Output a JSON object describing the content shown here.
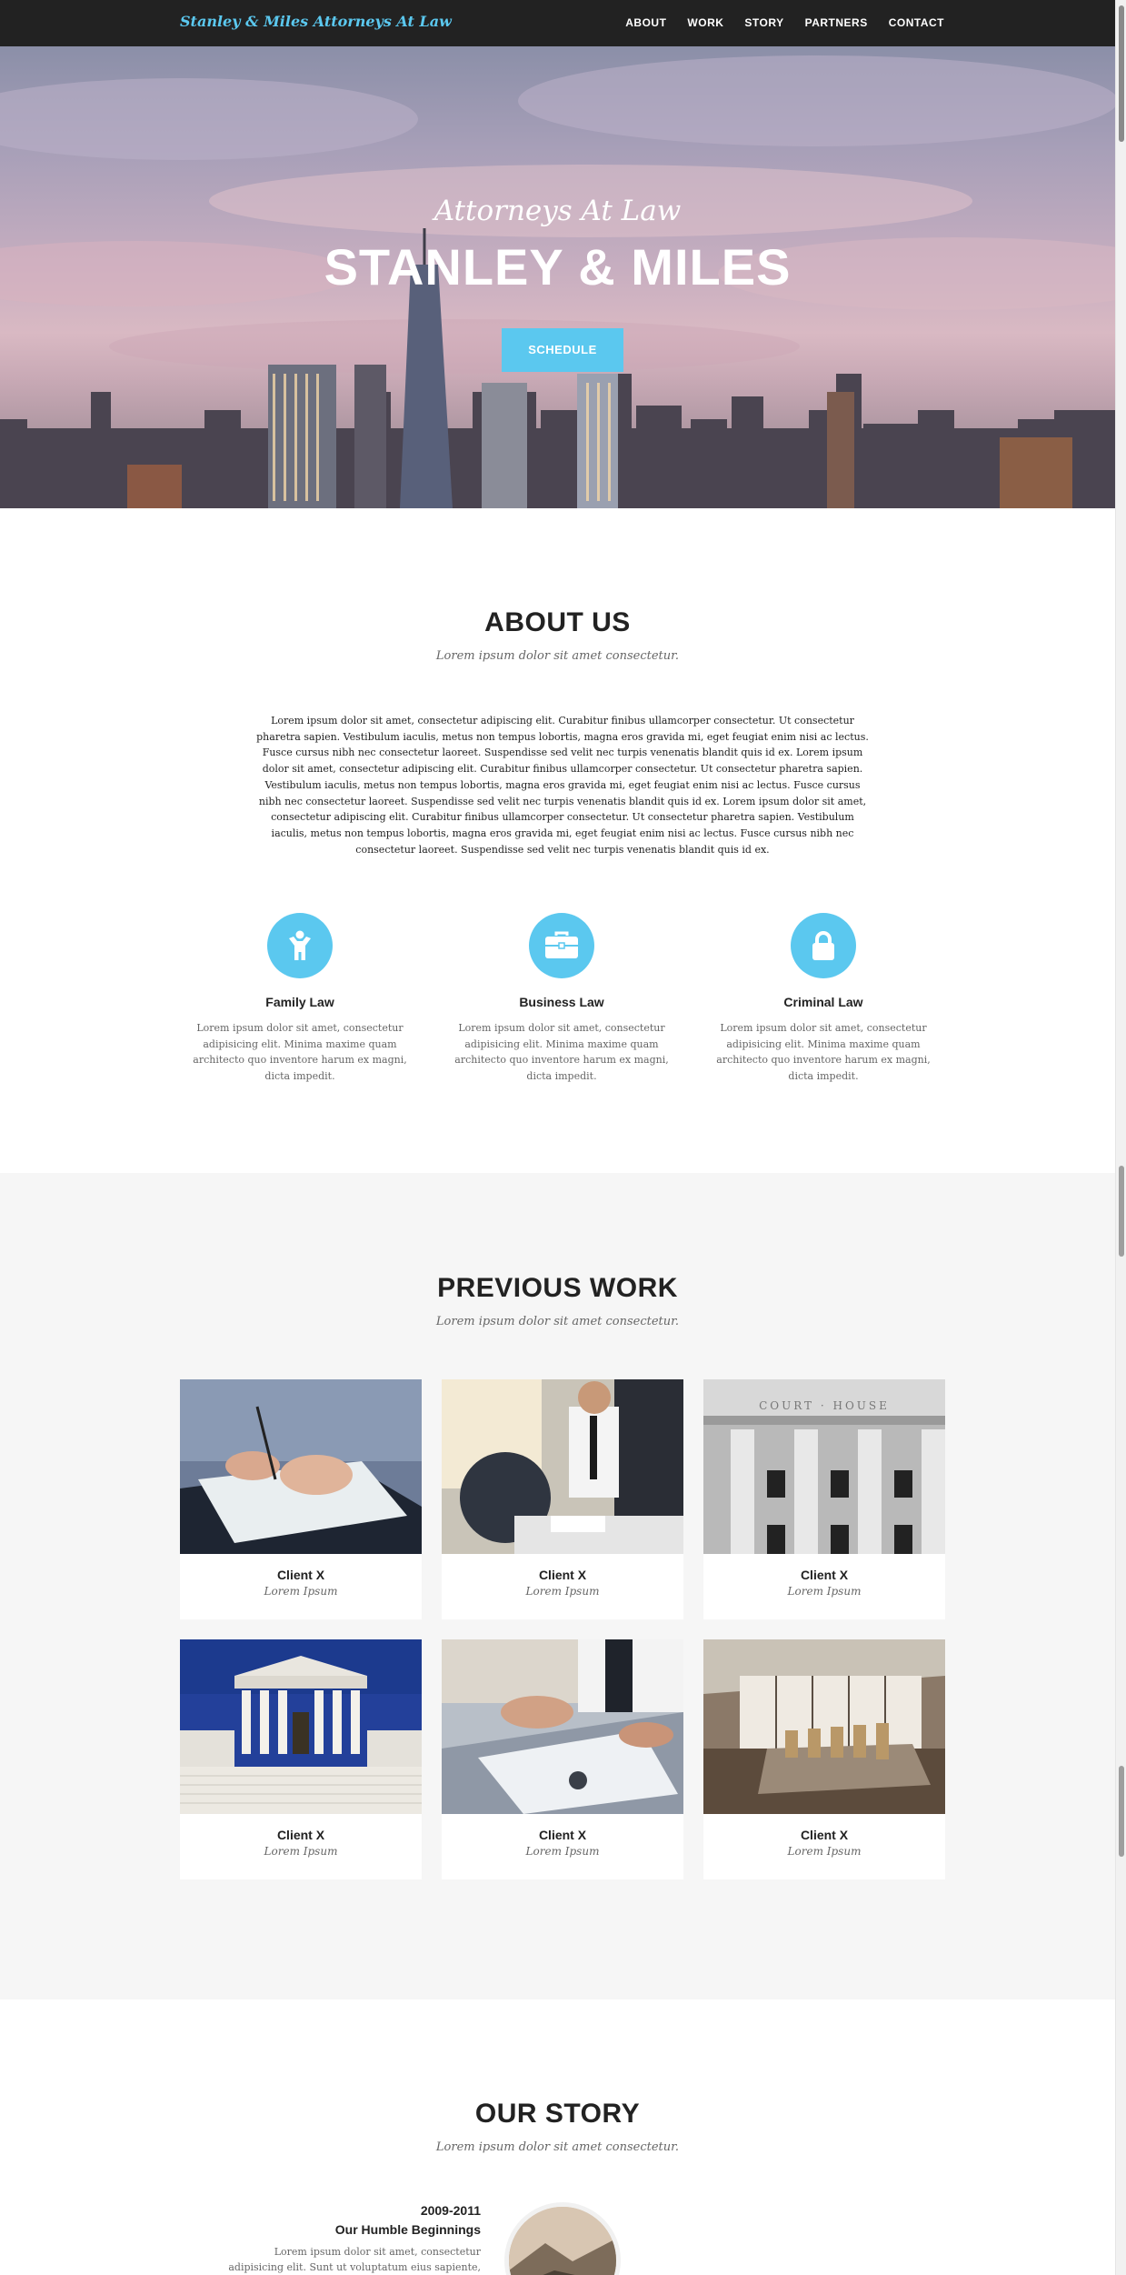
{
  "nav": {
    "brand": "Stanley & Miles Attorneys At Law",
    "items": [
      "ABOUT",
      "WORK",
      "STORY",
      "PARTNERS",
      "CONTACT"
    ]
  },
  "hero": {
    "subtitle": "Attorneys At Law",
    "title": "STANLEY & MILES",
    "button": "SCHEDULE"
  },
  "about": {
    "title": "ABOUT US",
    "subtitle": "Lorem ipsum dolor sit amet consectetur.",
    "body": "Lorem ipsum dolor sit amet, consectetur adipiscing elit. Curabitur finibus ullamcorper consectetur. Ut consectetur pharetra sapien. Vestibulum iaculis, metus non tempus lobortis, magna eros gravida mi, eget feugiat enim nisi ac lectus. Fusce cursus nibh nec consectetur laoreet. Suspendisse sed velit nec turpis venenatis blandit quis id ex. Lorem ipsum dolor sit amet, consectetur adipiscing elit. Curabitur finibus ullamcorper consectetur. Ut consectetur pharetra sapien. Vestibulum iaculis, metus non tempus lobortis, magna eros gravida mi, eget feugiat enim nisi ac lectus. Fusce cursus nibh nec consectetur laoreet. Suspendisse sed velit nec turpis venenatis blandit quis id ex. Lorem ipsum dolor sit amet, consectetur adipiscing elit. Curabitur finibus ullamcorper consectetur. Ut consectetur pharetra sapien. Vestibulum iaculis, metus non tempus lobortis, magna eros gravida mi, eget feugiat enim nisi ac lectus. Fusce cursus nibh nec consectetur laoreet. Suspendisse sed velit nec turpis venenatis blandit quis id ex.",
    "services": [
      {
        "icon": "child-icon",
        "title": "Family Law",
        "text": "Lorem ipsum dolor sit amet, consectetur adipisicing elit. Minima maxime quam architecto quo inventore harum ex magni, dicta impedit."
      },
      {
        "icon": "briefcase-icon",
        "title": "Business Law",
        "text": "Lorem ipsum dolor sit amet, consectetur adipisicing elit. Minima maxime quam architecto quo inventore harum ex magni, dicta impedit."
      },
      {
        "icon": "lock-icon",
        "title": "Criminal Law",
        "text": "Lorem ipsum dolor sit amet, consectetur adipisicing elit. Minima maxime quam architecto quo inventore harum ex magni, dicta impedit."
      }
    ]
  },
  "work": {
    "title": "PREVIOUS WORK",
    "subtitle": "Lorem ipsum dolor sit amet consectetur.",
    "items": [
      {
        "title": "Client X",
        "sub": "Lorem Ipsum"
      },
      {
        "title": "Client X",
        "sub": "Lorem Ipsum"
      },
      {
        "title": "Client X",
        "sub": "Lorem Ipsum"
      },
      {
        "title": "Client X",
        "sub": "Lorem Ipsum"
      },
      {
        "title": "Client X",
        "sub": "Lorem Ipsum"
      },
      {
        "title": "Client X",
        "sub": "Lorem Ipsum"
      }
    ]
  },
  "story": {
    "title": "OUR STORY",
    "subtitle": "Lorem ipsum dolor sit amet consectetur.",
    "year": "2009-2011",
    "heading": "Our Humble Beginnings",
    "text": "Lorem ipsum dolor sit amet, consectetur adipisicing elit. Sunt ut voluptatum eius sapiente, totam"
  },
  "colors": {
    "accent": "#5bc8ef",
    "nav_bg": "#222222",
    "section_alt": "#f6f6f6"
  }
}
